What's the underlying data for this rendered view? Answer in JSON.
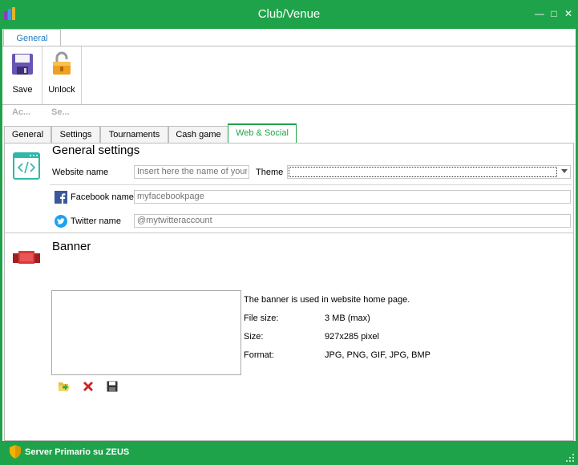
{
  "window": {
    "title": "Club/Venue"
  },
  "ribbon": {
    "tab_label": "General",
    "save_label": "Save",
    "unlock_label": "Unlock",
    "group_labels": [
      "Ac...",
      "Se..."
    ]
  },
  "tabs": [
    {
      "label": "General"
    },
    {
      "label": "Settings"
    },
    {
      "label": "Tournaments"
    },
    {
      "label": "Cash game"
    },
    {
      "label": "Web & Social",
      "active": true
    }
  ],
  "general": {
    "title": "General settings",
    "website_label": "Website name",
    "website_placeholder": "Insert here the name of your",
    "theme_label": "Theme",
    "theme_value": "",
    "facebook_label": "Facebook name",
    "facebook_placeholder": "myfacebookpage",
    "twitter_label": "Twitter name",
    "twitter_placeholder": "@mytwitteraccount"
  },
  "banner": {
    "title": "Banner",
    "description": "The banner is used in website home page.",
    "file_size_label": "File size:",
    "file_size_value": "3 MB (max)",
    "size_label": "Size:",
    "size_value": "927x285 pixel",
    "format_label": "Format:",
    "format_value": "JPG, PNG, GIF, JPG, BMP"
  },
  "status": {
    "text": "Server Primario su ZEUS"
  },
  "colors": {
    "accent": "#1fa34a",
    "link_blue": "#1e7bc6"
  }
}
